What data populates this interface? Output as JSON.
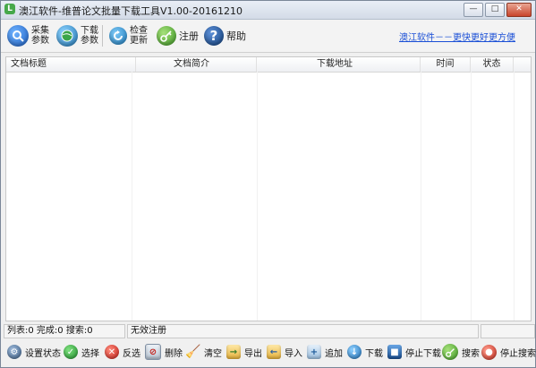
{
  "window": {
    "title": "澳江软件-维普论文批量下载工具V1.00-20161210",
    "controls": [
      "—",
      "□",
      "✕"
    ]
  },
  "toolbar": {
    "collect_params": [
      "采集",
      "参数"
    ],
    "download_params": [
      "下载",
      "参数"
    ],
    "check_update": [
      "检查",
      "更新"
    ],
    "register": "注册",
    "help": "帮助",
    "link": "澳江软件－－更快更好更方便"
  },
  "table": {
    "columns": [
      "文档标题",
      "文档简介",
      "下载地址",
      "时间",
      "状态"
    ]
  },
  "status": {
    "counts": "列表:0  完成:0  搜索:0",
    "registration": "无效注册"
  },
  "bottom_buttons": {
    "set_status": "设置状态",
    "select": "选择",
    "invert": "反选",
    "delete": "删除",
    "clear": "清空",
    "export": "导出",
    "import": "导入",
    "append": "追加",
    "download": "下载",
    "stop_download": "停止下载",
    "search": "搜索",
    "stop_search": "停止搜索"
  },
  "colors": {
    "link": "#1a4fd6",
    "window_border": "#7a8798",
    "close_button": "#c8432b"
  }
}
